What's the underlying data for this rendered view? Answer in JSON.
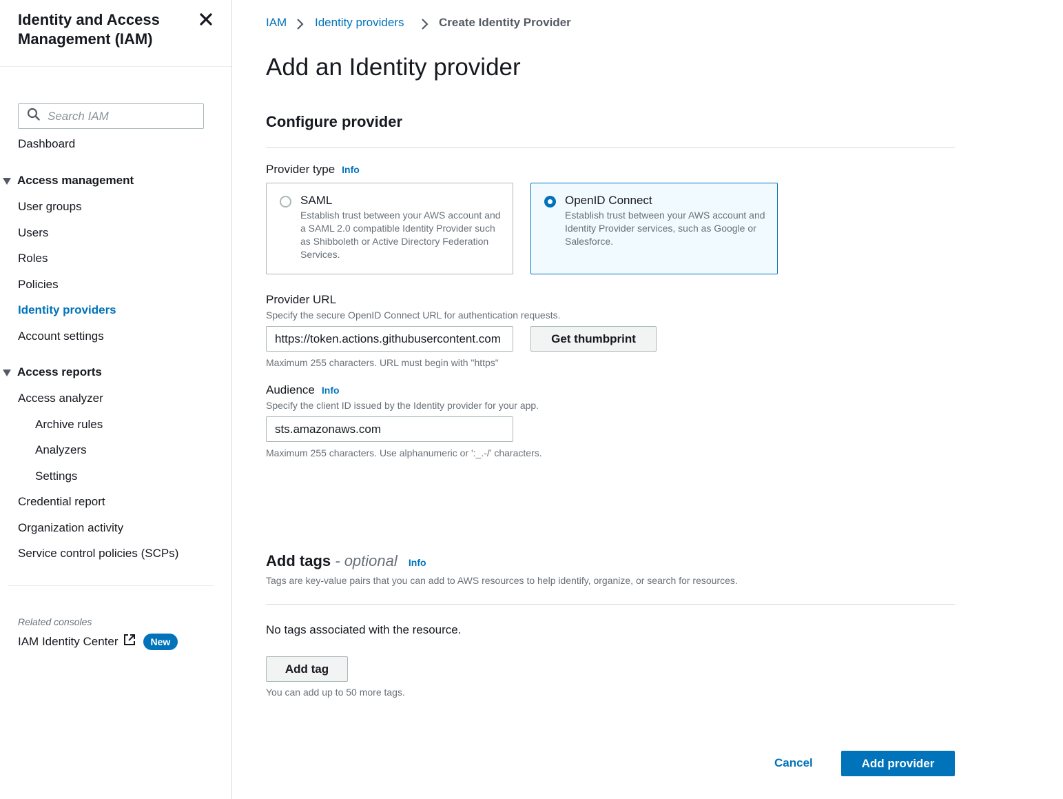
{
  "sidebar": {
    "title": "Identity and Access Management (IAM)",
    "search_placeholder": "Search IAM",
    "dashboard": "Dashboard",
    "access_management": {
      "label": "Access management",
      "items": [
        "User groups",
        "Users",
        "Roles",
        "Policies",
        "Identity providers",
        "Account settings"
      ],
      "active": "Identity providers"
    },
    "access_reports": {
      "label": "Access reports",
      "items": [
        "Access analyzer",
        "Archive rules",
        "Analyzers",
        "Settings",
        "Credential report",
        "Organization activity",
        "Service control policies (SCPs)"
      ]
    },
    "related_consoles": {
      "label": "Related consoles",
      "link": "IAM Identity Center",
      "badge": "New"
    }
  },
  "breadcrumb": [
    "IAM",
    "Identity providers",
    "Create Identity Provider"
  ],
  "page_title": "Add an Identity provider",
  "configure": {
    "heading": "Configure provider",
    "provider_type_label": "Provider type",
    "info": "Info",
    "options": [
      {
        "title": "SAML",
        "description": "Establish trust between your AWS account and a SAML 2.0 compatible Identity Provider such as Shibboleth or Active Directory Federation Services.",
        "selected": false
      },
      {
        "title": "OpenID Connect",
        "description": "Establish trust between your AWS account and Identity Provider services, such as Google or Salesforce.",
        "selected": true
      }
    ],
    "provider_url": {
      "label": "Provider URL",
      "description": "Specify the secure OpenID Connect URL for authentication requests.",
      "value": "https://token.actions.githubusercontent.com",
      "button": "Get thumbprint",
      "hint": "Maximum 255 characters. URL must begin with \"https\""
    },
    "audience": {
      "label": "Audience",
      "info": "Info",
      "description": "Specify the client ID issued by the Identity provider for your app.",
      "value": "sts.amazonaws.com",
      "hint": "Maximum 255 characters. Use alphanumeric or ':_.-/' characters."
    }
  },
  "tags": {
    "heading": "Add tags",
    "optional": "- optional",
    "info": "Info",
    "description": "Tags are key-value pairs that you can add to AWS resources to help identify, organize, or search for resources.",
    "empty": "No tags associated with the resource.",
    "add_button": "Add tag",
    "limit": "You can add up to 50 more tags."
  },
  "footer": {
    "cancel": "Cancel",
    "submit": "Add provider"
  },
  "colors": {
    "accent": "#0073bb",
    "selected_bg": "#f1faff",
    "muted_text": "#687078"
  }
}
